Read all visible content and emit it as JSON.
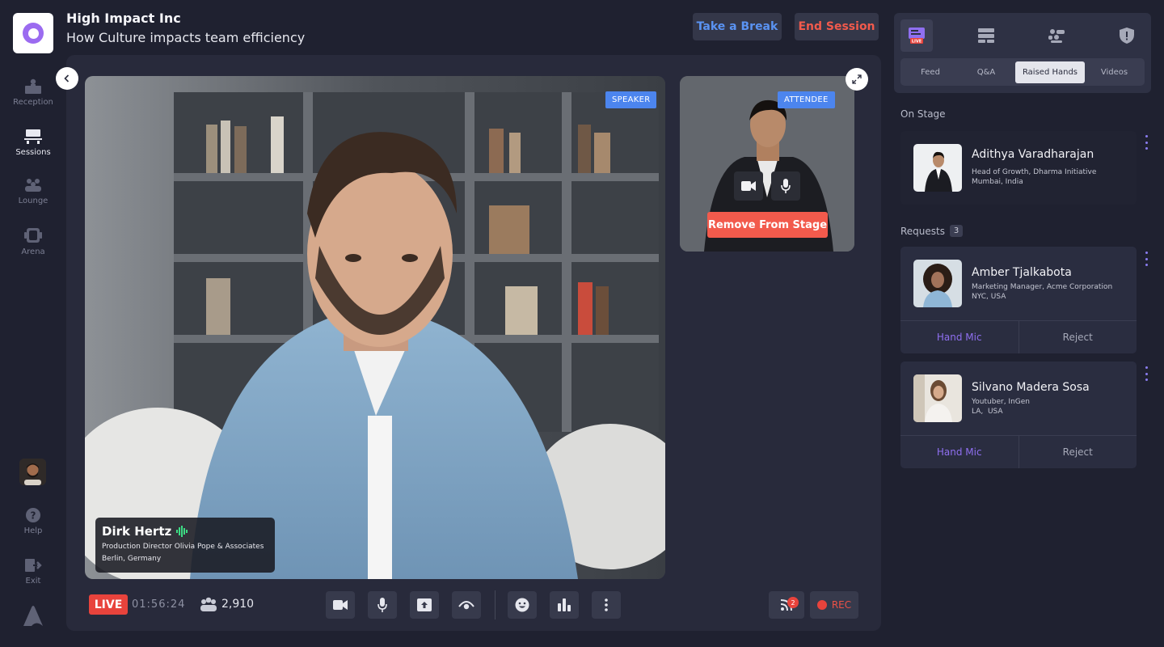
{
  "header": {
    "org_name": "High Impact Inc",
    "session_title": "How Culture impacts team efficiency",
    "take_break_label": "Take a Break",
    "end_session_label": "End Session"
  },
  "sidebar": {
    "items": [
      {
        "label": "Reception",
        "icon": "reception-icon"
      },
      {
        "label": "Sessions",
        "icon": "sessions-icon"
      },
      {
        "label": "Lounge",
        "icon": "lounge-icon"
      },
      {
        "label": "Arena",
        "icon": "arena-icon"
      }
    ],
    "help_label": "Help",
    "exit_label": "Exit"
  },
  "stage": {
    "main_video": {
      "tag": "SPEAKER",
      "speaker_name": "Dirk Hertz",
      "speaker_role": "Production Director Olivia Pope & Associates",
      "speaker_location": "Berlin, Germany"
    },
    "attendee_video": {
      "tag": "ATTENDEE",
      "remove_label": "Remove From Stage"
    }
  },
  "bottom_bar": {
    "live_label": "LIVE",
    "elapsed": "01:56:24",
    "viewer_count": "2,910",
    "feed_notification_count": "2",
    "rec_label": "REC"
  },
  "right_panel": {
    "tabs": [
      {
        "label": "Feed"
      },
      {
        "label": "Q&A"
      },
      {
        "label": "Raised Hands"
      },
      {
        "label": "Videos"
      }
    ],
    "active_tab": "Raised Hands",
    "on_stage_label": "On Stage",
    "on_stage": {
      "name": "Adithya Varadharajan",
      "title": "Head of Growth, Dharma Initiative",
      "location": "Mumbai, India"
    },
    "requests_label": "Requests",
    "requests_count": "3",
    "requests": [
      {
        "name": "Amber Tjalkabota",
        "title": "Marketing Manager, Acme Corporation",
        "location": "NYC, USA",
        "primary_action": "Hand Mic",
        "secondary_action": "Reject"
      },
      {
        "name": "Silvano Madera Sosa",
        "title": "Youtuber, InGen",
        "location": "LA,  USA",
        "primary_action": "Hand Mic",
        "secondary_action": "Reject"
      }
    ]
  },
  "colors": {
    "background": "#1f2130",
    "stage": "#282a3b",
    "accent_blue": "#5a93f3",
    "accent_red": "#f25a4c",
    "accent_purple": "#8f6ff0",
    "live_red": "#e8433c",
    "tag_blue": "#4c85ee"
  }
}
